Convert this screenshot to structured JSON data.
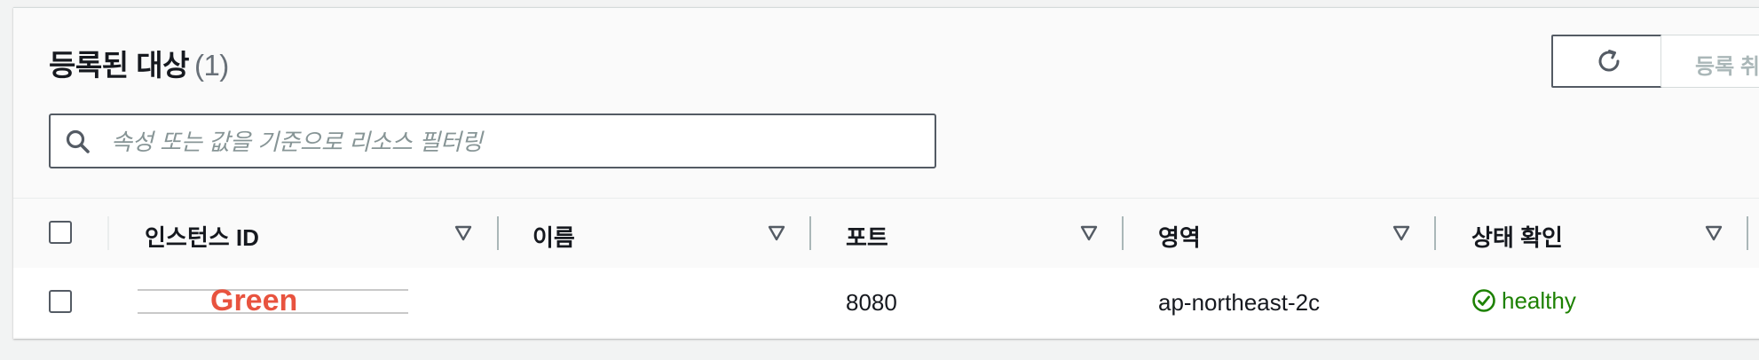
{
  "header": {
    "title": "등록된 대상",
    "count": "(1)",
    "deregister_label": "등록 취소"
  },
  "search": {
    "placeholder": "속성 또는 값을 기준으로 리소스 필터링",
    "value": ""
  },
  "table": {
    "columns": [
      "인스턴스 ID",
      "이름",
      "포트",
      "영역",
      "상태 확인"
    ],
    "rows": [
      {
        "instance_id": "",
        "annotation": "Green",
        "name": "",
        "port": "8080",
        "zone": "ap-northeast-2c",
        "health": "healthy"
      }
    ]
  },
  "colors": {
    "healthy": "#1d8102",
    "annotation": "#e8533f",
    "border": "#545b64"
  },
  "icons": {
    "refresh": "refresh-icon",
    "search": "search-icon",
    "sort": "sort-down-triangle-icon",
    "status_ok": "check-circle-icon"
  }
}
